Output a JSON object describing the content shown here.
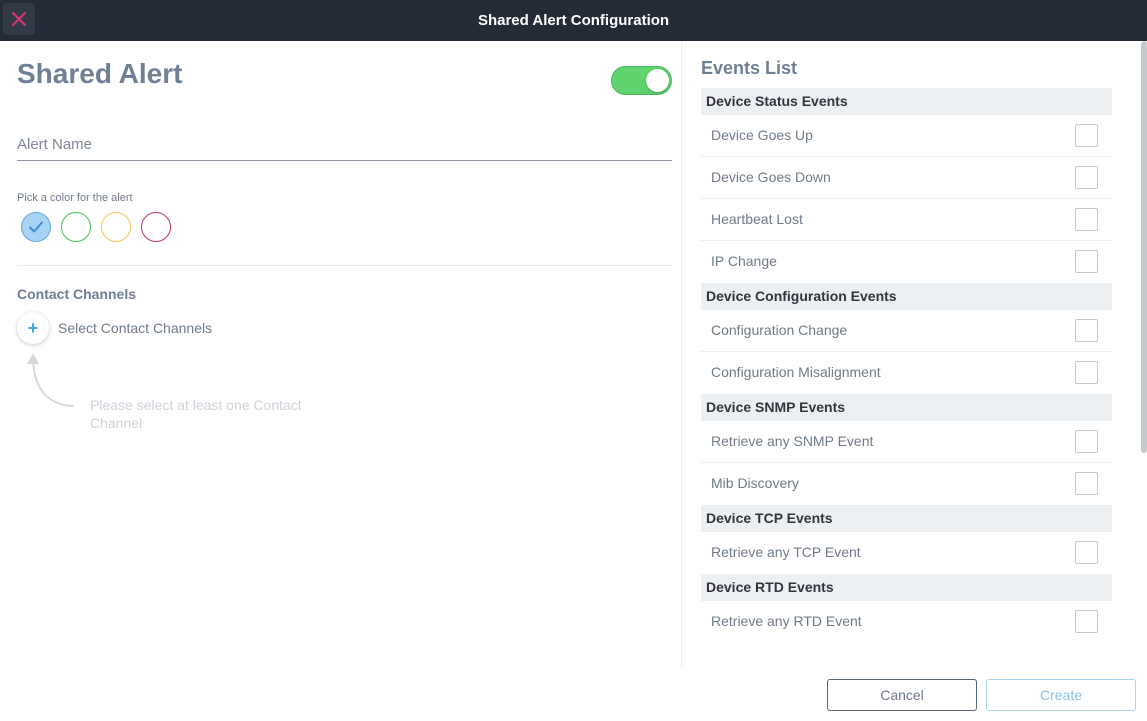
{
  "header": {
    "title": "Shared Alert Configuration"
  },
  "form": {
    "title": "Shared Alert",
    "toggle_on": true,
    "name_placeholder": "Alert Name",
    "color_label": "Pick a color for the alert",
    "colors": [
      "#a9d3f5",
      "#3fc34f",
      "#f6c451",
      "#c1306c"
    ],
    "selected_color_index": 0,
    "contact_channels": {
      "title": "Contact Channels",
      "add_label": "Select Contact Channels",
      "hint": "Please select at least one Contact Channel"
    }
  },
  "events": {
    "title": "Events List",
    "groups": [
      {
        "name": "Device Status Events",
        "items": [
          "Device Goes Up",
          "Device Goes Down",
          "Heartbeat Lost",
          "IP Change"
        ]
      },
      {
        "name": "Device Configuration Events",
        "items": [
          "Configuration Change",
          "Configuration Misalignment"
        ]
      },
      {
        "name": "Device SNMP Events",
        "items": [
          "Retrieve any SNMP Event",
          "Mib Discovery"
        ]
      },
      {
        "name": "Device TCP Events",
        "items": [
          "Retrieve any TCP Event"
        ]
      },
      {
        "name": "Device RTD Events",
        "items": [
          "Retrieve any RTD Event"
        ]
      }
    ]
  },
  "footer": {
    "cancel_label": "Cancel",
    "create_label": "Create"
  },
  "colors": {
    "header_bg": "#252b36",
    "close_icon": "#e0357a",
    "toggle_on": "#5fd36d",
    "title_text": "#6f8096"
  }
}
